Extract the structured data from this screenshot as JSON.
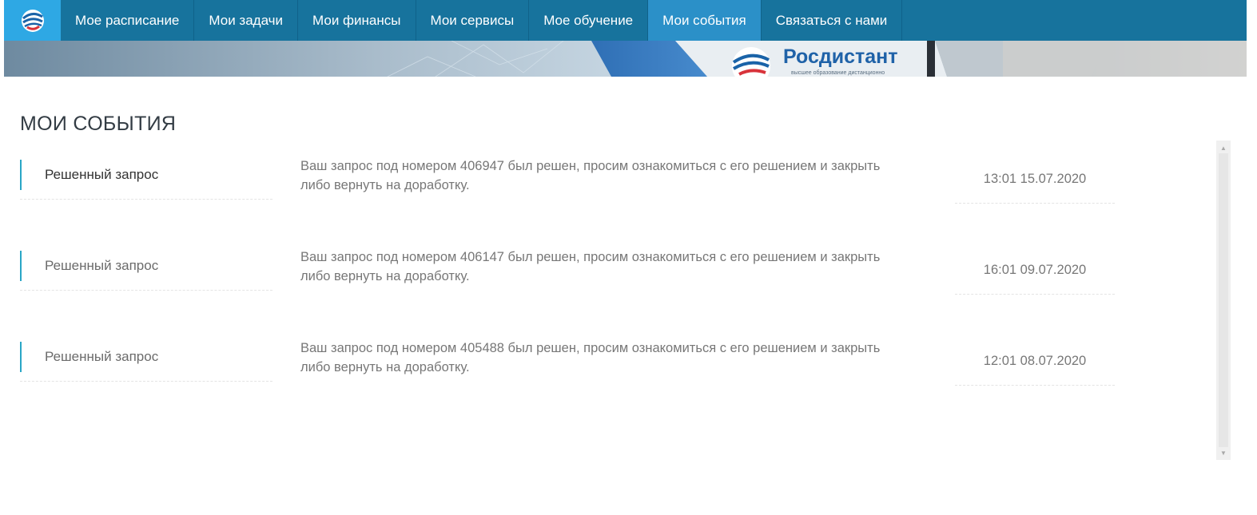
{
  "nav": {
    "items": [
      {
        "label": "Мое расписание"
      },
      {
        "label": "Мои задачи"
      },
      {
        "label": "Мои финансы"
      },
      {
        "label": "Мои сервисы"
      },
      {
        "label": "Мое обучение"
      },
      {
        "label": "Мои события"
      },
      {
        "label": "Связаться с нами"
      }
    ],
    "active_index": 5
  },
  "banner": {
    "brand": "Росдистант",
    "tagline": "высшее образование дистанционно"
  },
  "page": {
    "title": "МОИ СОБЫТИЯ"
  },
  "events": [
    {
      "title": "Решенный запрос",
      "message": "Ваш запрос под номером 406947 был решен, просим ознакомиться с его решением и закрыть либо вернуть на доработку.",
      "time": "13:01 15.07.2020"
    },
    {
      "title": "Решенный запрос",
      "message": "Ваш запрос под номером 406147 был решен, просим ознакомиться с его решением и закрыть либо вернуть на доработку.",
      "time": "16:01 09.07.2020"
    },
    {
      "title": "Решенный запрос",
      "message": "Ваш запрос под номером 405488 был решен, просим ознакомиться с его решением и закрыть либо вернуть на доработку.",
      "time": "12:01 08.07.2020"
    }
  ],
  "colors": {
    "nav_bg": "#17739d",
    "nav_active": "#2b90c8",
    "logo_bg": "#2ea8e4",
    "accent_bar": "#29a6c6"
  }
}
